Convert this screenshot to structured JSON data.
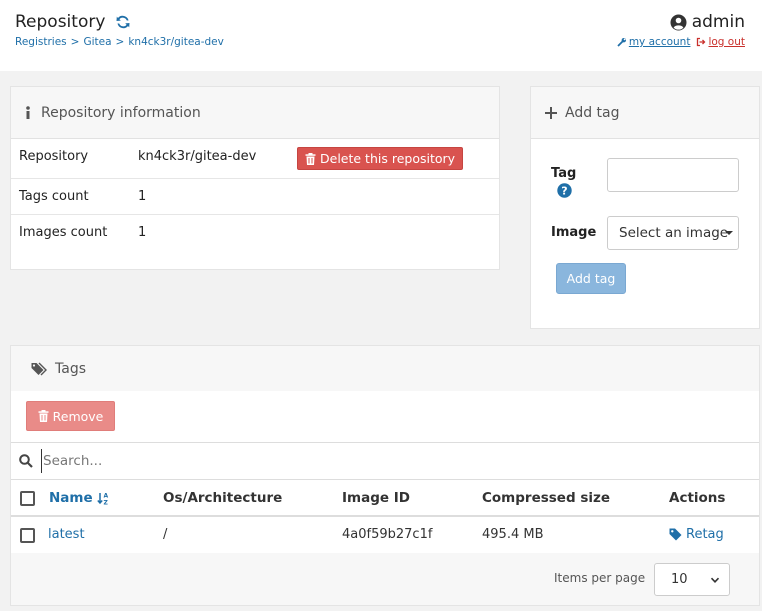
{
  "header": {
    "title": "Repository",
    "breadcrumb": [
      "Registries",
      "Gitea",
      "kn4ck3r/gitea-dev"
    ],
    "breadcrumb_sep": ">",
    "username": "admin",
    "my_account": "my account",
    "log_out": "log out"
  },
  "repo_info": {
    "heading": "Repository information",
    "rows": [
      {
        "label": "Repository",
        "value": "kn4ck3r/gitea-dev"
      },
      {
        "label": "Tags count",
        "value": "1"
      },
      {
        "label": "Images count",
        "value": "1"
      }
    ],
    "delete_label": "Delete this repository"
  },
  "add_tag": {
    "heading": "Add tag",
    "tag_label": "Tag",
    "tag_value": "",
    "image_label": "Image",
    "image_placeholder": "Select an image",
    "submit_label": "Add tag"
  },
  "tags": {
    "heading": "Tags",
    "remove_label": "Remove",
    "search_placeholder": "Search...",
    "columns": [
      "Name",
      "Os/Architecture",
      "Image ID",
      "Compressed size",
      "Actions"
    ],
    "rows": [
      {
        "name": "latest",
        "os_arch": "/",
        "image_id": "4a0f59b27c1f",
        "size": "495.4 MB",
        "action": "Retag"
      }
    ],
    "items_per_page_label": "Items per page",
    "items_per_page_value": "10"
  },
  "colors": {
    "link": "#1f6fa8",
    "danger": "#d9534f",
    "danger_disabled": "#e98b88",
    "primary_disabled": "#8ab6dd"
  }
}
